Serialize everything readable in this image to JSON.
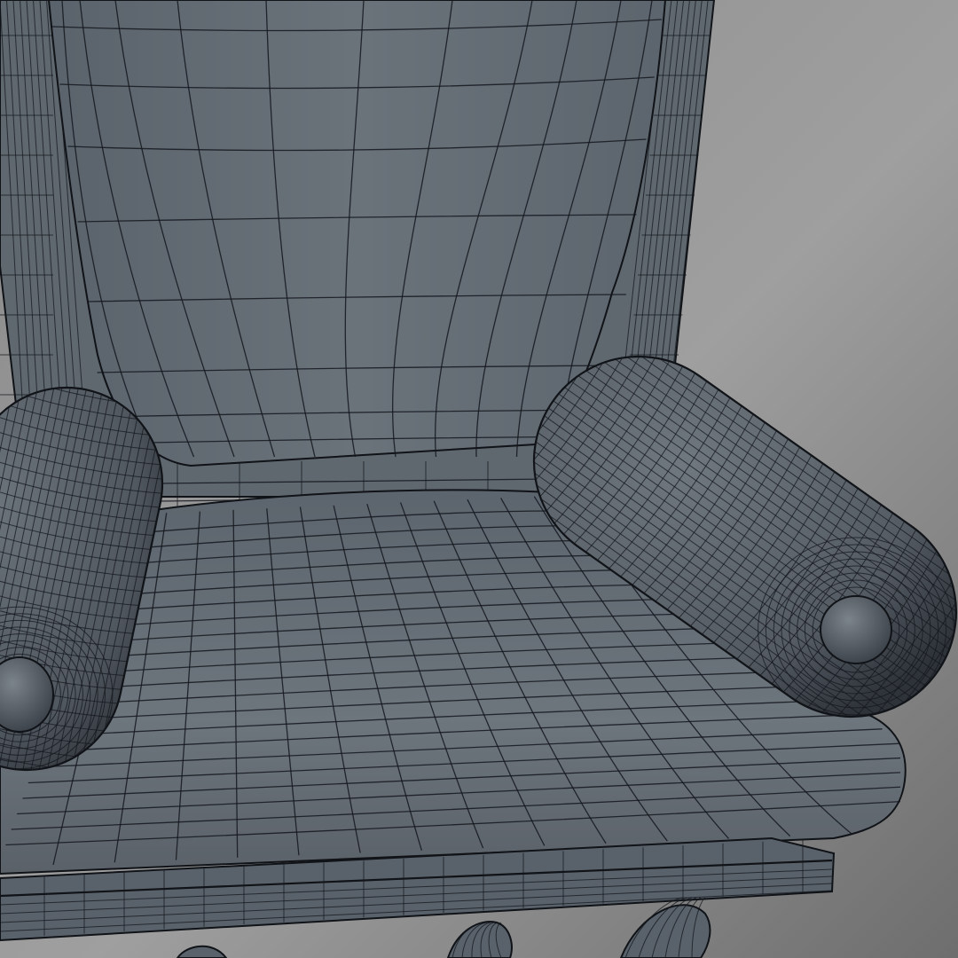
{
  "scene": {
    "subject_icon": "armchair-wireframe-icon",
    "colors": {
      "background_light": "#9c9c9c",
      "background_dark": "#6f6f6f",
      "mesh_light": "#6c747c",
      "mesh_mid": "#59616a",
      "mesh_dark": "#3a4048",
      "wire": "#14181d"
    }
  }
}
